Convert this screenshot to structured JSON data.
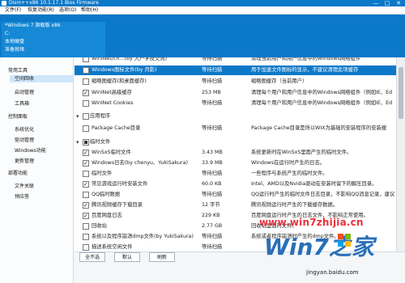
{
  "window": {
    "title": "Dism++x86 10.1.17.1 Bios Firmware",
    "controls": [
      "—",
      "□",
      "✕"
    ]
  },
  "menu": [
    "文件(F)",
    "恢复功能(R)",
    "选项(O)",
    "帮助(H)"
  ],
  "header": {
    "lines": [
      "*Windows 7 旗舰版 x86",
      "C:",
      "本地硬盘",
      "准备就绪"
    ]
  },
  "sidebar": {
    "groups": [
      {
        "label": "常用工具",
        "items": [
          "空间回收",
          "启动管理",
          "工具箱"
        ]
      },
      {
        "label": "控制面板",
        "items": [
          "系统优化",
          "驱动管理",
          "Windows功能",
          "更新管理"
        ]
      },
      {
        "label": "部署功能",
        "items": [
          "文件关联",
          "预应答"
        ]
      }
    ],
    "active_item": "空间回收"
  },
  "list": {
    "rows": [
      {
        "type": "item",
        "name": "WinINet/ch…(by 大户学技交流)",
        "status": "等待扫描",
        "size": "",
        "desc": "清理当前用户和用户信息中的Windows网络组件",
        "checked": false
      },
      {
        "type": "item",
        "name": "Windows图标文件(by 月影)",
        "status": "等待扫描",
        "size": "",
        "desc": "用于加速文件图标的显示，不建议清理此项缓存",
        "checked": false,
        "selected": true
      },
      {
        "type": "item",
        "name": "缩略图缓存(和桌面缓存)",
        "status": "等待扫描",
        "size": "",
        "desc": "缩略图缓存（当前用户）",
        "checked": false
      },
      {
        "type": "item",
        "name": "WinINet高级缓存",
        "status": "",
        "size": "253 MB",
        "desc": "清理每个用户和用户信息中的Windows网络组件（例如IE、Ed",
        "checked": true
      },
      {
        "type": "item",
        "name": "WinINet Cookies",
        "status": "等待扫描",
        "size": "",
        "desc": "清理每个用户和用户信息中的Windows网络组件（例如IE、Ed",
        "checked": false
      },
      {
        "type": "group",
        "name": "应用程序",
        "checked": false
      },
      {
        "type": "item",
        "name": "Package Cache目录",
        "status": "等待扫描",
        "size": "",
        "desc": "Package Cache目录是所以WIX为基础的安装程序的安装缓",
        "checked": false
      },
      {
        "type": "group",
        "name": "临时文件",
        "checked": "partial"
      },
      {
        "type": "item",
        "name": "WinSxS临时文件",
        "status": "",
        "size": "3.43 MB",
        "desc": "系统更新时在WinSxS里面产生的临时文件。",
        "checked": true
      },
      {
        "type": "item",
        "name": "Windows日志(by chenyu、YukiSakura)",
        "status": "",
        "size": "33.9 MB",
        "desc": "Windows在运行时产生的日志。",
        "checked": true
      },
      {
        "type": "item",
        "name": "临时文件",
        "status": "等待扫描",
        "size": "",
        "desc": "一些程序与系统产生的临时文件。",
        "checked": false
      },
      {
        "type": "item",
        "name": "常见游戏运行时安装文件",
        "status": "",
        "size": "60.0 KB",
        "desc": "Intel、AMD以及Nvidia驱动在安装时留下的解压目录。",
        "checked": true
      },
      {
        "type": "item",
        "name": "QQ临时数据",
        "status": "等待扫描",
        "size": "",
        "desc": "QQ运行时产生的临时文件日志目录，不影响QQ消息记录，建议",
        "checked": false
      },
      {
        "type": "item",
        "name": "腾讯视频缓存下载目录",
        "status": "",
        "size": "12 字节",
        "desc": "腾讯视频运行时产生的下载缓存数据。",
        "checked": true
      },
      {
        "type": "item",
        "name": "百度网盘日志",
        "status": "",
        "size": "229 KB",
        "desc": "百度网盘运行时产生的日志文件，不影响正常使用。",
        "checked": true
      },
      {
        "type": "item",
        "name": "回收站",
        "status": "",
        "size": "2.77 GB",
        "desc": "回收站里面的文件。",
        "checked": false
      },
      {
        "type": "item",
        "name": "系统以及程序崩溃dmp文件(by YukiSakura)",
        "status": "等待扫描",
        "size": "",
        "desc": "系统或者程序崩溃时产生的dmp文件。",
        "checked": false
      },
      {
        "type": "item",
        "name": "描述系统空闲文件",
        "status": "等待扫描",
        "size": "",
        "desc": "",
        "checked": false
      }
    ]
  },
  "buttons": {
    "select_all": "全不选",
    "default": "默认",
    "refresh": "刷新"
  },
  "watermark": {
    "site": "www.win7zhijia.cn",
    "logo": "Win7之家",
    "url": "jingyan.baidu.com"
  }
}
